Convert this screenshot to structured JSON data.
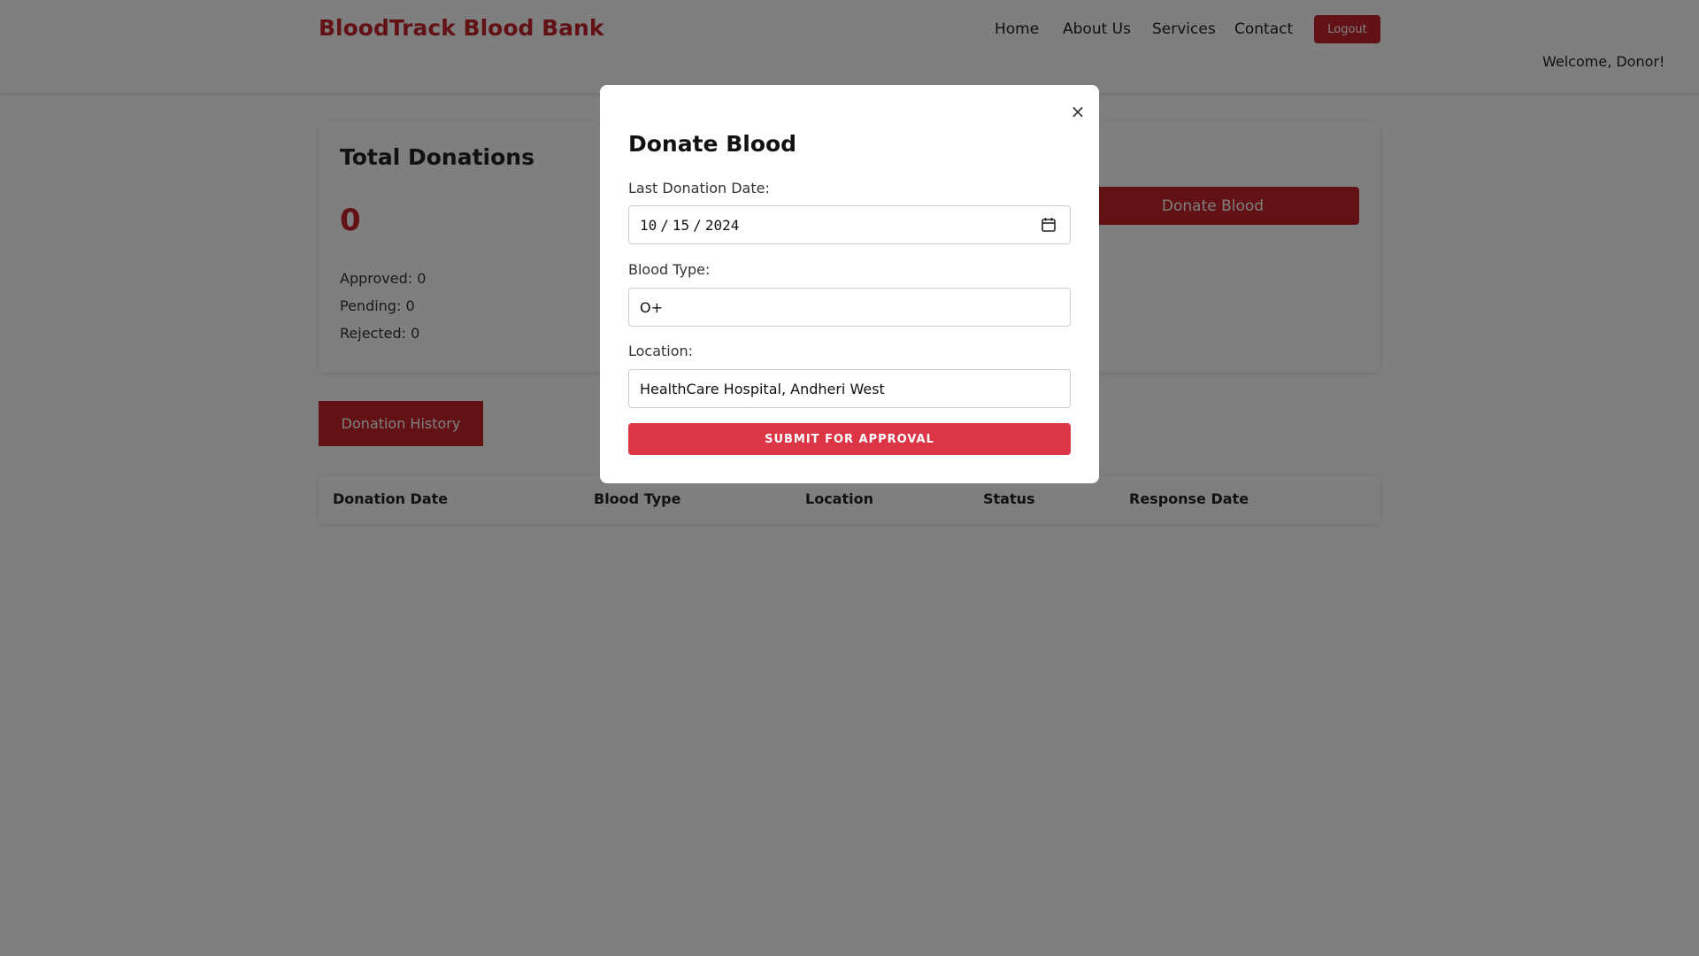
{
  "navbar": {
    "brand": "BloodTrack Blood Bank",
    "links": [
      "Home",
      "About Us",
      "Services",
      "Contact"
    ],
    "logout_label": "Logout",
    "welcome": "Welcome, Donor!"
  },
  "summary": {
    "title": "Total Donations",
    "total": "0",
    "approved": "Approved: 0",
    "pending": "Pending: 0",
    "rejected": "Rejected: 0",
    "donate_button_label": "Donate Blood"
  },
  "history": {
    "tab_label": "Donation History",
    "columns": [
      "Donation Date",
      "Blood Type",
      "Location",
      "Status",
      "Response Date"
    ]
  },
  "modal": {
    "close_label": "×",
    "title": "Donate Blood",
    "date_label": "Last Donation Date:",
    "date_month": "10",
    "date_day": "15",
    "date_year": "2024",
    "date_sep": "/",
    "blood_type_label": "Blood Type:",
    "blood_type_value": "O+",
    "location_label": "Location:",
    "location_value": "HealthCare Hospital, Andheri West",
    "submit_label": "SUBMIT FOR APPROVAL"
  },
  "colors": {
    "brand_red": "#c4242b",
    "submit_red": "#dc3545",
    "overlay": "rgba(0,0,0,0.5)"
  },
  "icons": {
    "close": "close-icon",
    "calendar": "calendar-icon"
  }
}
